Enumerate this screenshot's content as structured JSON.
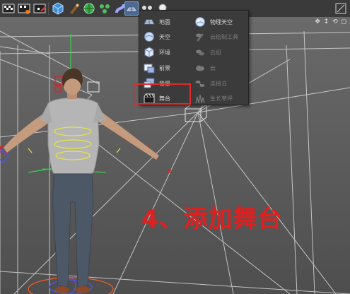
{
  "toolbar": {
    "buttons": [
      {
        "name": "render-picture-viewer-icon"
      },
      {
        "name": "edit-render-settings-icon"
      },
      {
        "name": "cube-primitive-icon"
      },
      {
        "name": "pen-spline-icon"
      },
      {
        "name": "nurbs-subdivision-icon"
      },
      {
        "name": "array-cloner-icon"
      },
      {
        "name": "deformer-icon"
      },
      {
        "name": "environment-floor-icon"
      },
      {
        "name": "camera-icon"
      },
      {
        "name": "light-icon"
      }
    ]
  },
  "viewport": {
    "nav_icons": "✥ ↕ ⟲ ◻"
  },
  "menu": {
    "left_items": [
      {
        "label": "地面",
        "icon": "floor-icon"
      },
      {
        "label": "天空",
        "icon": "sky-icon"
      },
      {
        "label": "环境",
        "icon": "environment-icon"
      },
      {
        "label": "前景",
        "icon": "foreground-icon"
      },
      {
        "label": "背景",
        "icon": "background-icon"
      },
      {
        "label": "舞台",
        "icon": "stage-clapper-icon"
      }
    ],
    "right_items": [
      {
        "label": "物理天空",
        "icon": "physical-sky-icon",
        "enabled": true
      },
      {
        "label": "云绘制工具",
        "icon": "cloud-paint-tool-icon",
        "enabled": false
      },
      {
        "label": "云组",
        "icon": "cloud-group-icon",
        "enabled": false
      },
      {
        "label": "云",
        "icon": "cloud-icon",
        "enabled": false
      },
      {
        "label": "连接云",
        "icon": "connect-clouds-icon",
        "enabled": false
      },
      {
        "label": "生长草坪",
        "icon": "grow-grass-icon",
        "enabled": false
      }
    ],
    "highlighted": "舞台"
  },
  "annotation": {
    "text": "4、添加舞台",
    "color": "#e01f1f"
  }
}
